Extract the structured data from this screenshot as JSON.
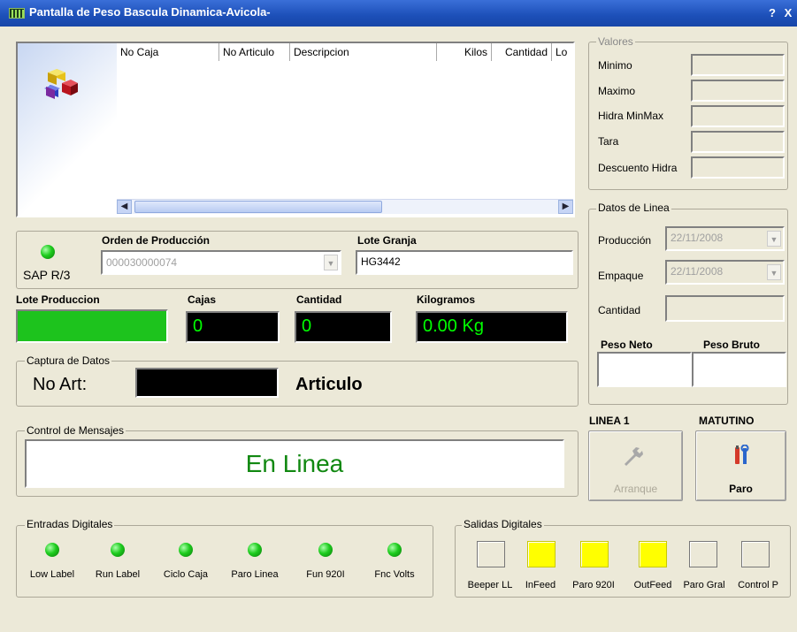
{
  "window": {
    "title": "Pantalla de Peso Bascula Dinamica-Avicola-",
    "help_label": "?",
    "close_label": "X"
  },
  "grid": {
    "columns": [
      "No Caja",
      "No Articulo",
      "Descripcion",
      "Kilos",
      "Cantidad",
      "Lo"
    ]
  },
  "valores": {
    "legend": "Valores",
    "rows": [
      "Minimo",
      "Maximo",
      "Hidra MinMax",
      "Tara",
      "Descuento Hidra"
    ]
  },
  "orden": {
    "sap_label": "SAP R/3",
    "orden_label": "Orden de Producción",
    "orden_value": "000030000074",
    "lote_granja_label": "Lote Granja",
    "lote_granja_value": "HG3442"
  },
  "datos_linea": {
    "legend": "Datos de Linea",
    "produccion_label": "Producción",
    "produccion_value": "22/11/2008",
    "empaque_label": "Empaque",
    "empaque_value": "22/11/2008",
    "cantidad_label": "Cantidad",
    "peso_neto_label": "Peso Neto",
    "peso_bruto_label": "Peso Bruto"
  },
  "metrics": {
    "lote_produccion_label": "Lote Produccion",
    "cajas_label": "Cajas",
    "cajas_value": "0",
    "cantidad_label": "Cantidad",
    "cantidad_value": "0",
    "kilogramos_label": "Kilogramos",
    "kilogramos_value": "0.00 Kg"
  },
  "captura": {
    "legend": "Captura de Datos",
    "no_art_label": "No Art:",
    "articulo_label": "Articulo"
  },
  "mensajes": {
    "legend": "Control de Mensajes",
    "message": "En Linea"
  },
  "linea": {
    "linea_label": "LINEA 1",
    "turno_label": "MATUTINO",
    "arranque_label": "Arranque",
    "paro_label": "Paro"
  },
  "entradas": {
    "legend": "Entradas Digitales",
    "items": [
      "Low Label",
      "Run Label",
      "Ciclo Caja",
      "Paro Linea",
      "Fun 920I",
      "Fnc Volts"
    ]
  },
  "salidas": {
    "legend": "Salidas Digitales",
    "items": [
      "Beeper LL",
      "InFeed",
      "Paro 920I",
      "OutFeed",
      "Paro Gral",
      "Control P"
    ]
  },
  "colors": {
    "titlebar": "#1c4fb8",
    "led_on": "#1ecc1e",
    "output_on": "#ffff00",
    "status_text": "#118811",
    "display_text": "#00ff00",
    "lote_fill": "#1dc31d"
  }
}
